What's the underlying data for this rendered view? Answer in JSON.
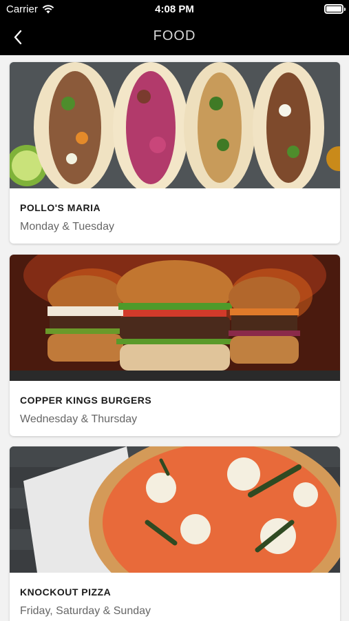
{
  "status_bar": {
    "carrier": "Carrier",
    "time": "4:08 PM"
  },
  "nav": {
    "title": "FOOD",
    "back_icon": "chevron-left-icon"
  },
  "vendors": [
    {
      "name": "POLLO'S MARIA",
      "days": "Monday & Tuesday",
      "image": "tacos-photo"
    },
    {
      "name": "COPPER KINGS BURGERS",
      "days": "Wednesday & Thursday",
      "image": "burgers-photo"
    },
    {
      "name": "KNOCKOUT PIZZA",
      "days": "Friday, Saturday & Sunday",
      "image": "pizza-photo"
    }
  ]
}
